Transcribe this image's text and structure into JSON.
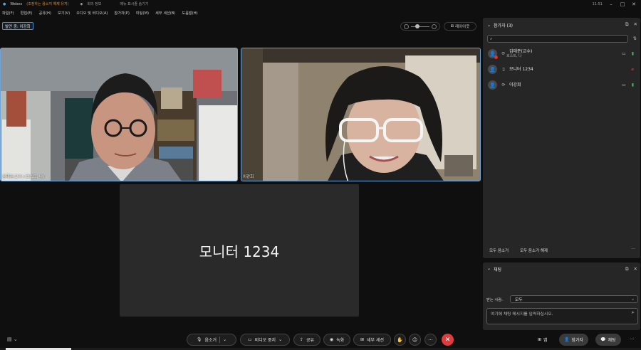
{
  "titlebar": {
    "app_name": "Webex",
    "notice": "(조정하는 용소지 해제 유지)",
    "meeting_info": "회의 정보",
    "hide_menu": "메뉴 표시줄 숨기기",
    "clock": "11:51"
  },
  "menu": [
    "파일(F)",
    "편집(E)",
    "공유(H)",
    "보기(V)",
    "오디오 및 비디오(A)",
    "참가자(P)",
    "미팅(M)",
    "세부 세션(B)",
    "도움말(H)"
  ],
  "speaking_chip": "발언 중: 이강희",
  "layout_button": "레이아웃",
  "videos": [
    {
      "name": "김태준(교수) (호스트, 나)"
    },
    {
      "name": "이강희"
    }
  ],
  "monitor_tile": {
    "label": "모니터 1234"
  },
  "participants_panel": {
    "title": "참가자 (3)",
    "participants": [
      {
        "name": "김태준(교수)",
        "role": "호스트, 나",
        "mic": "on",
        "cam": "on"
      },
      {
        "name": "모니터 1234",
        "role": "",
        "mic": "off",
        "cam": "off"
      },
      {
        "name": "이강희",
        "role": "",
        "mic": "on",
        "cam": "on"
      }
    ],
    "mute_all": "모두 음소거",
    "unmute_all": "모두 음소거 해제"
  },
  "chat_panel": {
    "title": "채팅",
    "to_label": "받는 사람:",
    "to_value": "모두",
    "input_placeholder": "여기에 채팅 메시지를 입력하십시오."
  },
  "controls": {
    "mute": "음소거",
    "stop_video": "비디오 중지",
    "share": "공유",
    "record": "녹화",
    "breakout": "세부 세션",
    "apps": "앱",
    "participants": "참가자",
    "chat": "채팅"
  },
  "colors": {
    "accent_blue": "#6fa4d8",
    "end_red": "#e23b3b",
    "mic_on_green": "#39b56a",
    "mic_off_red": "#e0455a"
  }
}
